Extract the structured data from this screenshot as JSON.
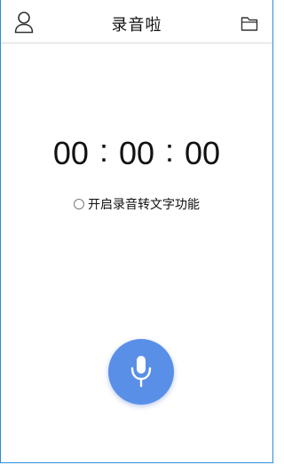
{
  "header": {
    "title": "录音啦",
    "profile_icon": "user-icon",
    "folder_icon": "folder-icon"
  },
  "timer": {
    "hours": "00",
    "minutes": "00",
    "seconds": "00",
    "separator": ":"
  },
  "transcription": {
    "label": "开启录音转文字功能",
    "enabled": false
  },
  "record": {
    "icon": "microphone-icon",
    "button_color": "#5a8fe8"
  }
}
